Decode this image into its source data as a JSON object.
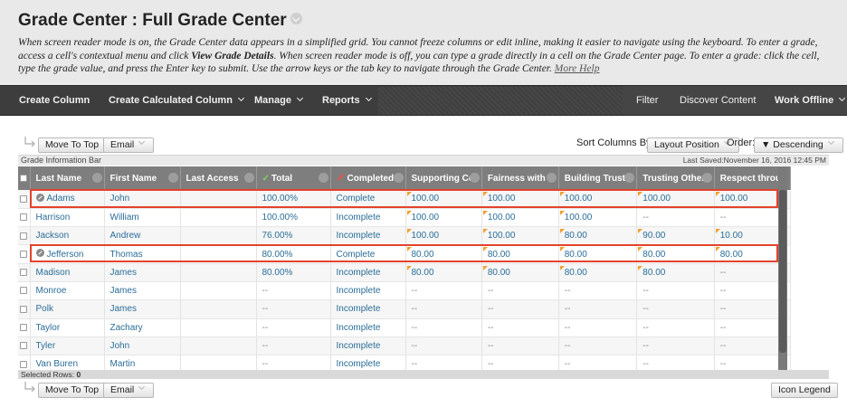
{
  "header": {
    "title": "Grade Center : Full Grade Center",
    "instructions_part1": "When screen reader mode is on, the Grade Center data appears in a simplified grid. You cannot freeze columns or edit inline, making it easier to navigate using the keyboard. To enter a grade, access a cell's contextual menu and click ",
    "instructions_bold": "View Grade Details",
    "instructions_part2": ". When screen reader mode is off, you can type a grade directly in a cell on the Grade Center page. To enter a grade: click the cell, type the grade value, and press the Enter key to submit. Use the arrow keys or the tab key to navigate through the Grade Center. ",
    "more_help": "More Help"
  },
  "nav": {
    "create_column": "Create Column",
    "create_calculated_column": "Create Calculated Column",
    "manage": "Manage",
    "reports": "Reports",
    "filter": "Filter",
    "discover_content": "Discover Content",
    "work_offline": "Work Offline"
  },
  "toolbar_top": {
    "move_to_top": "Move To Top",
    "email": "Email",
    "sort_columns_by_label": "Sort Columns By:",
    "sort_value": "Layout Position",
    "order_label": "Order:",
    "order_value": "▼ Descending"
  },
  "info_bar": {
    "label": "Grade Information Bar",
    "last_saved": "Last Saved:November 16, 2016 12:45 PM"
  },
  "grid": {
    "columns": [
      "Last Name",
      "First Name",
      "Last Access",
      "Total",
      "Completed",
      "Supporting Cor",
      "Fairness with C",
      "Building Trust v",
      "Trusting Others",
      "Respect throug"
    ],
    "rows": [
      {
        "last": "Adams",
        "first": "John",
        "access": "",
        "total": "100.00%",
        "completed": "Complete",
        "c1": "100.00",
        "c2": "100.00",
        "c3": "100.00",
        "c4": "100.00",
        "c5": "100.00",
        "needs": true
      },
      {
        "last": "Harrison",
        "first": "William",
        "access": "",
        "total": "100.00%",
        "completed": "Incomplete",
        "c1": "100.00",
        "c2": "100.00",
        "c3": "100.00",
        "c4": "--",
        "c5": "--",
        "needs": false
      },
      {
        "last": "Jackson",
        "first": "Andrew",
        "access": "",
        "total": "76.00%",
        "completed": "Incomplete",
        "c1": "100.00",
        "c2": "100.00",
        "c3": "80.00",
        "c4": "90.00",
        "c5": "10.00",
        "needs": false
      },
      {
        "last": "Jefferson",
        "first": "Thomas",
        "access": "",
        "total": "80.00%",
        "completed": "Complete",
        "c1": "80.00",
        "c2": "80.00",
        "c3": "80.00",
        "c4": "80.00",
        "c5": "80.00",
        "needs": true
      },
      {
        "last": "Madison",
        "first": "James",
        "access": "",
        "total": "80.00%",
        "completed": "Incomplete",
        "c1": "80.00",
        "c2": "80.00",
        "c3": "80.00",
        "c4": "80.00",
        "c5": "--",
        "needs": false
      },
      {
        "last": "Monroe",
        "first": "James",
        "access": "",
        "total": "--",
        "completed": "Incomplete",
        "c1": "--",
        "c2": "--",
        "c3": "--",
        "c4": "--",
        "c5": "--",
        "needs": false
      },
      {
        "last": "Polk",
        "first": "James",
        "access": "",
        "total": "--",
        "completed": "Incomplete",
        "c1": "--",
        "c2": "--",
        "c3": "--",
        "c4": "--",
        "c5": "--",
        "needs": false
      },
      {
        "last": "Taylor",
        "first": "Zachary",
        "access": "",
        "total": "--",
        "completed": "Incomplete",
        "c1": "--",
        "c2": "--",
        "c3": "--",
        "c4": "--",
        "c5": "--",
        "needs": false
      },
      {
        "last": "Tyler",
        "first": "John",
        "access": "",
        "total": "--",
        "completed": "Incomplete",
        "c1": "--",
        "c2": "--",
        "c3": "--",
        "c4": "--",
        "c5": "--",
        "needs": false
      },
      {
        "last": "Van Buren",
        "first": "Martin",
        "access": "",
        "total": "--",
        "completed": "Incomplete",
        "c1": "--",
        "c2": "--",
        "c3": "--",
        "c4": "--",
        "c5": "--",
        "needs": false
      }
    ]
  },
  "footer": {
    "selected_rows_label": "Selected Rows:",
    "selected_rows_count": "0",
    "move_to_top": "Move To Top",
    "email": "Email",
    "icon_legend": "Icon Legend"
  },
  "colors": {
    "nav_bg": "#3d3d3d",
    "header_row_bg": "#7e7e7e",
    "link_blue": "#2a6d97",
    "highlight_red": "#e4422a"
  }
}
